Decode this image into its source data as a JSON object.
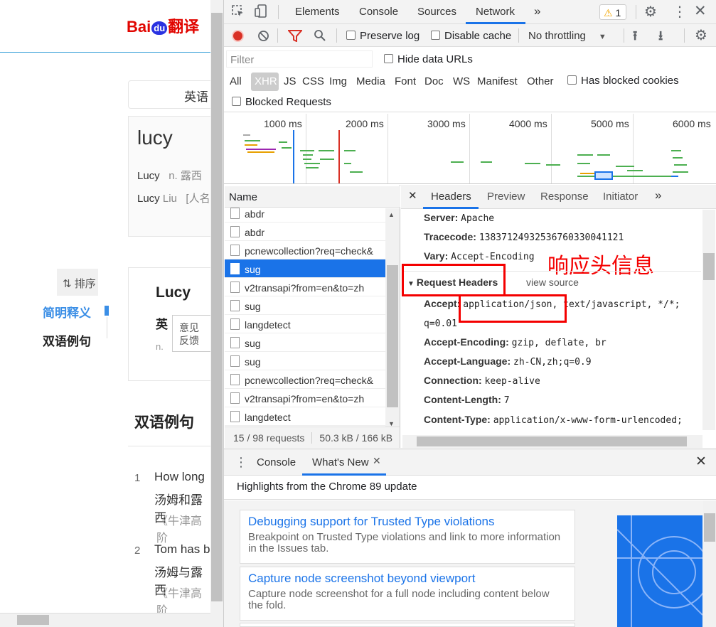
{
  "left_page": {
    "logo_left": "Bai",
    "logo_du": "du",
    "logo_right": "翻译",
    "lang_select": "英语",
    "word": "lucy",
    "definitions": [
      {
        "term": "Lucy",
        "text": "n. 露西"
      },
      {
        "term": "Lucy",
        "term2": "Liu",
        "text": "[人名"
      }
    ],
    "sort_label": "⇅ 排序",
    "nav": [
      "简明释义",
      "双语例句"
    ],
    "card_word": "Lucy",
    "card_en": "英",
    "card_n": "n.",
    "feedback": [
      "意见",
      "反馈"
    ],
    "section_title": "双语例句",
    "examples": [
      {
        "num": "1",
        "en": "How long",
        "cn": "汤姆和露西",
        "src": "《牛津高阶"
      },
      {
        "num": "2",
        "en": "Tom has b",
        "cn": "汤姆与露西",
        "src": "《牛津高阶"
      }
    ]
  },
  "devtools": {
    "main_tabs": [
      "Elements",
      "Console",
      "Sources",
      "Network"
    ],
    "active_tab": "Network",
    "warning_count": "1",
    "toolbar": {
      "preserve_log": "Preserve log",
      "disable_cache": "Disable cache",
      "throttling": "No throttling"
    },
    "filter_placeholder": "Filter",
    "hide_data_urls": "Hide data URLs",
    "type_filters": [
      "All",
      "XHR",
      "JS",
      "CSS",
      "Img",
      "Media",
      "Font",
      "Doc",
      "WS",
      "Manifest",
      "Other"
    ],
    "active_type": "XHR",
    "has_blocked_cookies": "Has blocked cookies",
    "blocked_requests": "Blocked Requests",
    "timeline_ticks": [
      "1000 ms",
      "2000 ms",
      "3000 ms",
      "4000 ms",
      "5000 ms",
      "6000 ms"
    ],
    "name_header": "Name",
    "requests": [
      "abdr",
      "abdr",
      "pcnewcollection?req=check&",
      "sug",
      "v2transapi?from=en&to=zh",
      "sug",
      "langdetect",
      "sug",
      "sug",
      "pcnewcollection?req=check&",
      "v2transapi?from=en&to=zh",
      "langdetect"
    ],
    "selected_request_index": 3,
    "status_requests": "15 / 98 requests",
    "status_size": "50.3 kB / 166 kB",
    "detail_tabs": [
      "Headers",
      "Preview",
      "Response",
      "Initiator"
    ],
    "active_detail_tab": "Headers",
    "response_headers": [
      {
        "k": "Server:",
        "v": "Apache"
      },
      {
        "k": "Tracecode:",
        "v": "13837124932536760330041121"
      },
      {
        "k": "Vary:",
        "v": "Accept-Encoding"
      }
    ],
    "annotation": "响应头信息",
    "request_headers_title": "Request Headers",
    "view_source": "view source",
    "request_headers": [
      {
        "k": "Accept:",
        "v": "application/json, text/javascript, */*;"
      },
      {
        "k": "",
        "v": "q=0.01"
      },
      {
        "k": "Accept-Encoding:",
        "v": "gzip, deflate, br"
      },
      {
        "k": "Accept-Language:",
        "v": "zh-CN,zh;q=0.9"
      },
      {
        "k": "Connection:",
        "v": "keep-alive"
      },
      {
        "k": "Content-Length:",
        "v": "7"
      },
      {
        "k": "Content-Type:",
        "v": "application/x-www-form-urlencoded;"
      }
    ],
    "drawer_tabs": [
      "Console",
      "What's New"
    ],
    "active_drawer_tab": "What's New",
    "highlights": "Highlights from the Chrome 89 update",
    "whats_new": [
      {
        "title": "Debugging support for Trusted Type violations",
        "desc": "Breakpoint on Trusted Type violations and link to more information in the Issues tab."
      },
      {
        "title": "Capture node screenshot beyond viewport",
        "desc": "Capture node screenshot for a full node including content below the fold."
      }
    ],
    "icons": {
      "inspect": "inspect-icon",
      "device": "device-toggle-icon",
      "more_tabs": "chevron-double-right-icon",
      "settings": "gear-icon",
      "menu": "kebab-icon",
      "record": "record-icon",
      "clear": "clear-icon",
      "filter": "filter-icon",
      "search": "search-icon",
      "upload": "upload-icon",
      "download": "download-icon",
      "close": "close-icon",
      "warning": "warning-icon"
    },
    "colors": {
      "record": "#d93025",
      "filter": "#d93025",
      "selected": "#1a73e8",
      "accent": "#1a73e8",
      "annotation": "#f40000"
    }
  }
}
